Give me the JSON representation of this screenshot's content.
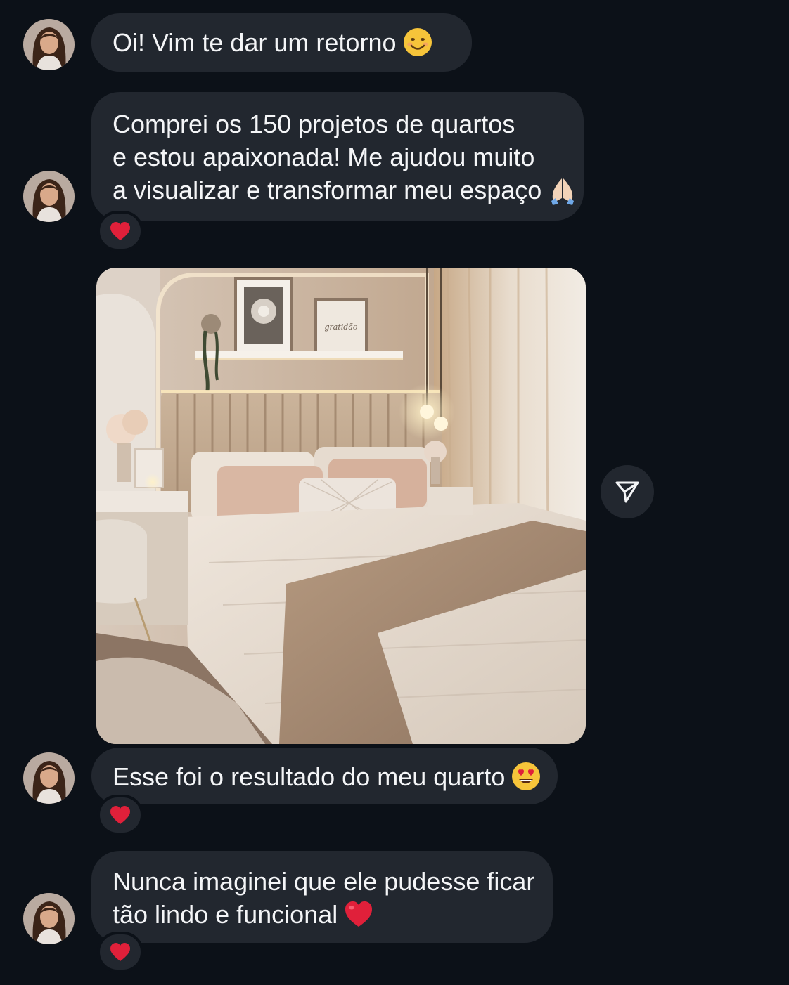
{
  "messages": [
    {
      "lines": [
        "Oi! Vim te dar um retorno"
      ],
      "emoji": "😊",
      "reaction": null
    },
    {
      "lines": [
        "Comprei os 150 projetos de quartos",
        "e estou apaixonada! Me ajudou muito",
        "a visualizar e transformar meu espaço"
      ],
      "emoji": "🙏🏻",
      "reaction": "❤️"
    },
    {
      "type": "image",
      "image_alt": "Foto do quarto decorado",
      "frame_text": "gratidão"
    },
    {
      "lines": [
        "Esse foi o resultado do meu quarto"
      ],
      "emoji": "😍",
      "reaction": "❤️"
    },
    {
      "lines": [
        "Nunca imaginei que ele pudesse ficar",
        "tão lindo e funcional"
      ],
      "emoji": "❤️",
      "reaction": "❤️"
    }
  ],
  "icons": {
    "share": "paper-plane-icon",
    "reaction": "red-heart-icon",
    "avatar": "user-avatar"
  },
  "colors": {
    "background": "#0c1118",
    "bubble": "#22272f",
    "text": "#f4f5f7",
    "heart": "#e0203a"
  }
}
